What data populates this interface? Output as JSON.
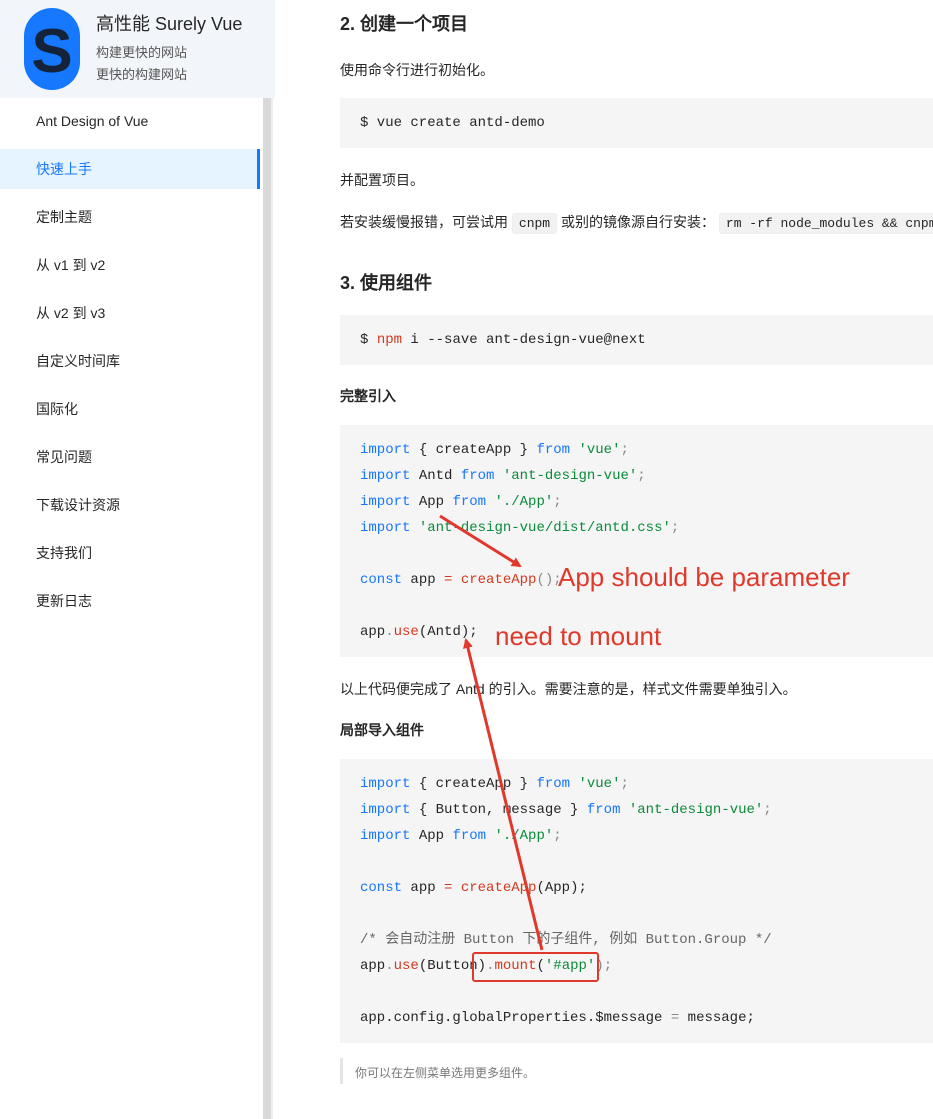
{
  "site": {
    "logo_letter": "S",
    "title": "高性能 Surely Vue",
    "subtitle_1": "构建更快的网站",
    "subtitle_2": "更快的构建网站"
  },
  "menu": {
    "items": [
      {
        "label": "Ant Design of Vue",
        "active": false
      },
      {
        "label": "快速上手",
        "active": true
      },
      {
        "label": "定制主题",
        "active": false
      },
      {
        "label": "从 v1 到 v2",
        "active": false
      },
      {
        "label": "从 v2 到 v3",
        "active": false
      },
      {
        "label": "自定义时间库",
        "active": false
      },
      {
        "label": "国际化",
        "active": false
      },
      {
        "label": "常见问题",
        "active": false
      },
      {
        "label": "下载设计资源",
        "active": false
      },
      {
        "label": "支持我们",
        "active": false
      },
      {
        "label": "更新日志",
        "active": false
      }
    ]
  },
  "content": {
    "h_create": "2. 创建一个项目",
    "p_init": "使用命令行进行初始化。",
    "code_create": "$ vue create antd-demo",
    "p_config": "并配置项目。",
    "p_mirror_a": "若安装缓慢报错，可尝试用",
    "p_mirror_code1": "cnpm",
    "p_mirror_b": "或别的镜像源自行安装：",
    "p_mirror_code2": "rm -rf node_modules && cnpm",
    "h_use": "3. 使用组件",
    "code_install_prompt": "$ ",
    "code_install_cmd": "npm",
    "code_install_rest": " i --save ant-design-vue@next",
    "h_full": "完整引入",
    "full_code": {
      "l1": [
        "import",
        " { createApp } ",
        "from",
        " ",
        "'vue'",
        ";"
      ],
      "l2": [
        "import",
        " Antd ",
        "from",
        " ",
        "'ant-design-vue'",
        ";"
      ],
      "l3": [
        "import",
        " App ",
        "from",
        " ",
        "'./App'",
        ";"
      ],
      "l4": [
        "import",
        " ",
        "'ant-design-vue/dist/antd.css'",
        ";"
      ],
      "l5": [
        "const",
        " app ",
        "=",
        " ",
        "createApp",
        "();"
      ],
      "l6": [
        "app",
        ".",
        "use",
        "(Antd);"
      ]
    },
    "p_full_done": "以上代码便完成了 Antd 的引入。需要注意的是，样式文件需要单独引入。",
    "h_partial": "局部导入组件",
    "partial_code": {
      "l1": [
        "import",
        " { createApp } ",
        "from",
        " ",
        "'vue'",
        ";"
      ],
      "l2": [
        "import",
        " { Button, message } ",
        "from",
        " ",
        "'ant-design-vue'",
        ";"
      ],
      "l3": [
        "import",
        " App ",
        "from",
        " ",
        "'./App'",
        ";"
      ],
      "l4": [
        "const",
        " app ",
        "=",
        " ",
        "createApp",
        "(App);"
      ],
      "l5": "/* 会自动注册 Button 下的子组件, 例如 Button.Group */",
      "l6": [
        "app",
        ".",
        "use",
        "(Button)",
        ".",
        "mount",
        "(",
        "'#app'",
        ");"
      ],
      "l7": [
        "app.config.globalProperties.$message ",
        "=",
        " message;"
      ]
    },
    "note": "你可以在左侧菜单选用更多组件。"
  },
  "annotations": {
    "app_param": "App should be parameter",
    "need_mount": "need to mount",
    "color": "#e0392b"
  },
  "colors": {
    "accent": "#1677ff",
    "keyword": "#1677ff",
    "string": "#0a8a3a",
    "function": "#d4381e",
    "sidebar_bg": "#f2f6fb",
    "code_bg": "#f5f5f5"
  }
}
